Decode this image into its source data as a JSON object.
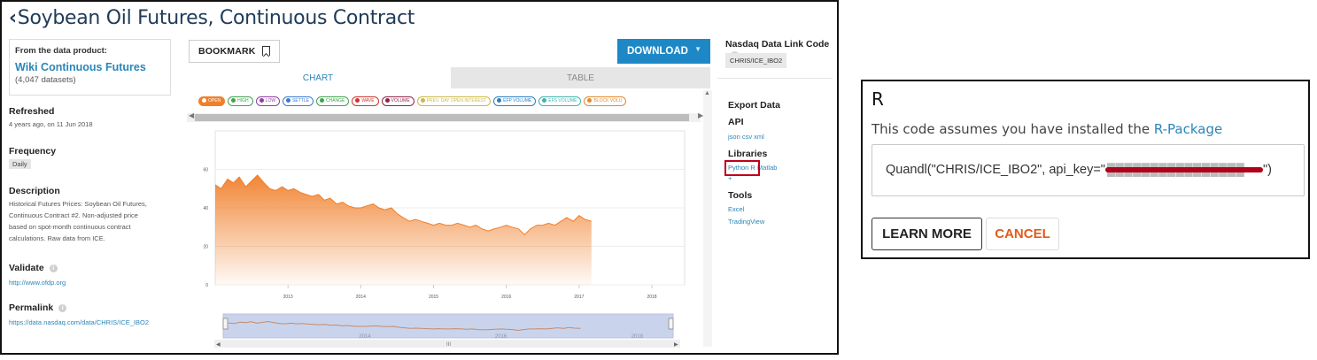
{
  "page": {
    "title": "Soybean Oil Futures, Continuous Contract",
    "back_icon": "chevron-left-icon"
  },
  "product": {
    "label": "From the data product:",
    "name": "Wiki Continuous Futures",
    "count": "(4,047 datasets)"
  },
  "sidebar": {
    "refreshed_label": "Refreshed",
    "refreshed_value": "4 years ago, on 11 Jun 2018",
    "frequency_label": "Frequency",
    "frequency_value": "Daily",
    "description_label": "Description",
    "description_lines": [
      "Historical Futures Prices: Soybean Oil Futures,",
      "Continuous Contract #2. Non-adjusted price",
      "based on spot-month continuous contract",
      "calculations. Raw data from ICE."
    ],
    "validate_label": "Validate",
    "validate_link": "http://www.ofdp.org",
    "permalink_label": "Permalink",
    "permalink_link": "https://data.nasdaq.com/data/CHRIS/ICE_IBO2"
  },
  "toolbar": {
    "bookmark_label": "BOOKMARK",
    "download_label": "DOWNLOAD"
  },
  "tabs": [
    {
      "label": "CHART",
      "active": true
    },
    {
      "label": "TABLE",
      "active": false
    }
  ],
  "series_toggles": [
    {
      "label": "OPEN",
      "color": "#f07f2a",
      "active": true
    },
    {
      "label": "HIGH",
      "color": "#3fa34d",
      "active": false
    },
    {
      "label": "LOW",
      "color": "#8e3fa0",
      "active": false
    },
    {
      "label": "SETTLE",
      "color": "#3b7bd1",
      "active": false
    },
    {
      "label": "CHANGE",
      "color": "#3fa34d",
      "active": false
    },
    {
      "label": "WAVE",
      "color": "#d0342c",
      "active": false
    },
    {
      "label": "VOLUME",
      "color": "#8e2447",
      "active": false
    },
    {
      "label": "PREV. DAY OPEN INTEREST",
      "color": "#c9b84a",
      "active": false
    },
    {
      "label": "EFP VOLUME",
      "color": "#2a7fc1",
      "active": false
    },
    {
      "label": "EFS VOLUME",
      "color": "#3fb3b0",
      "active": false
    },
    {
      "label": "BLOCK VOLU",
      "color": "#e28a2c",
      "active": false
    }
  ],
  "right_panel": {
    "code_label": "Nasdaq Data Link Code",
    "code_value": "CHRIS/ICE_IBO2",
    "export_label": "Export Data",
    "api_label": "API",
    "api_links": "json csv xml",
    "libraries_label": "Libraries",
    "libraries_links": "Python R Matlab",
    "libraries_more": "+",
    "tools_label": "Tools",
    "tools": [
      "Excel",
      "TradingView"
    ]
  },
  "chart_data": {
    "type": "area",
    "series_name": "OPEN",
    "color": "#f07f2a",
    "x_ticks": [
      "2013",
      "2014",
      "2015",
      "2016",
      "2017",
      "2018"
    ],
    "y_ticks": [
      0,
      20,
      40,
      60
    ],
    "ylim": [
      0,
      80
    ],
    "xlim": [
      2012.0,
      2018.45
    ],
    "x": [
      2012.0,
      2012.08,
      2012.17,
      2012.25,
      2012.33,
      2012.42,
      2012.5,
      2012.58,
      2012.67,
      2012.75,
      2012.83,
      2012.92,
      2013.0,
      2013.08,
      2013.17,
      2013.25,
      2013.33,
      2013.42,
      2013.5,
      2013.58,
      2013.67,
      2013.75,
      2013.83,
      2013.92,
      2014.0,
      2014.08,
      2014.17,
      2014.25,
      2014.33,
      2014.42,
      2014.5,
      2014.58,
      2014.67,
      2014.75,
      2014.83,
      2014.92,
      2015.0,
      2015.08,
      2015.17,
      2015.25,
      2015.33,
      2015.42,
      2015.5,
      2015.58,
      2015.67,
      2015.75,
      2015.83,
      2015.92,
      2016.0,
      2016.08,
      2016.17,
      2016.25,
      2016.33,
      2016.42,
      2016.5,
      2016.58,
      2016.67,
      2016.75,
      2016.83,
      2016.92,
      2017.0,
      2017.08,
      2017.17
    ],
    "y": [
      52,
      50,
      55,
      53,
      56,
      51,
      54,
      57,
      53,
      50,
      49,
      51,
      49,
      50,
      48,
      47,
      46,
      47,
      44,
      45,
      42,
      43,
      41,
      40,
      40,
      41,
      42,
      40,
      39,
      40,
      37,
      35,
      33,
      34,
      33,
      32,
      31,
      32,
      31,
      31,
      32,
      31,
      30,
      31,
      29,
      28,
      29,
      30,
      31,
      30,
      29,
      26,
      29,
      31,
      31,
      32,
      31,
      33,
      35,
      33,
      36,
      34,
      33
    ]
  },
  "navigator": {
    "x_ticks": [
      "2014",
      "2016",
      "2018"
    ]
  },
  "r_dialog": {
    "title": "R",
    "desc_prefix": "This code assumes you have installed the ",
    "desc_link": "R-Package",
    "code_prefix": "Quandl(\"CHRIS/ICE_IBO2\", api_key=\"",
    "code_suffix": "\")",
    "learn_more_label": "LEARN MORE",
    "cancel_label": "CANCEL"
  }
}
